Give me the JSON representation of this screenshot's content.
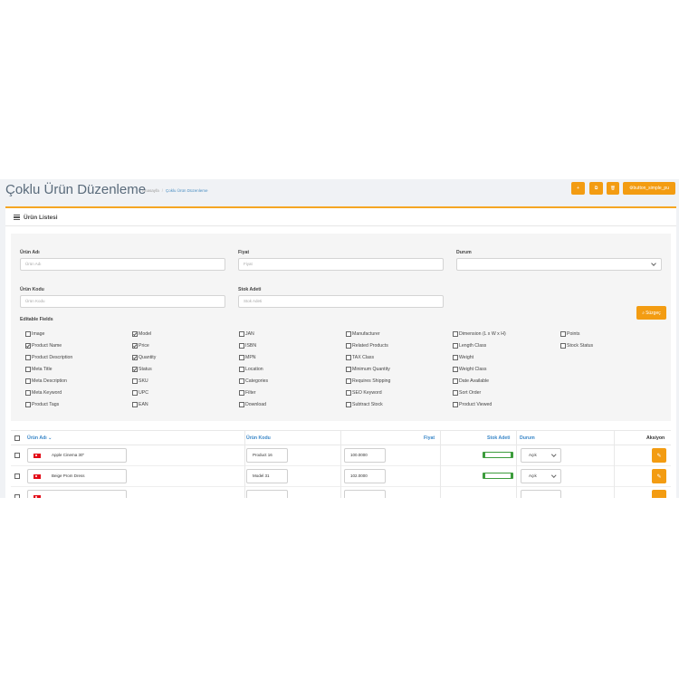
{
  "header": {
    "title": "Çoklu Ürün Düzenleme",
    "breadcrumb": [
      "Anasayfa",
      "Çoklu Ürün Düzenleme"
    ],
    "buttons": [
      {
        "icon": "plus-icon",
        "glyph": "+"
      },
      {
        "icon": "copy-icon",
        "glyph": "⧉"
      },
      {
        "icon": "trash-icon",
        "glyph": "🗑"
      },
      {
        "icon": "gear-icon",
        "glyph": "⚙",
        "label": "button_simple_pu"
      }
    ]
  },
  "panel": {
    "title": "Ürün Listesi"
  },
  "filters": {
    "product_name": {
      "label": "Ürün Adı",
      "placeholder": "Ürün Adı"
    },
    "price": {
      "label": "Fiyat",
      "placeholder": "Fiyat"
    },
    "status": {
      "label": "Durum",
      "value": ""
    },
    "product_code": {
      "label": "Ürün Kodu",
      "placeholder": "Ürün Kodu"
    },
    "stock": {
      "label": "Stok Adeti",
      "placeholder": "Stok Adeti"
    },
    "search_button": "Süzgeç"
  },
  "editable_fields": {
    "label": "Editable Fields",
    "columns": [
      [
        {
          "label": "Image",
          "checked": false
        },
        {
          "label": "Product Name",
          "checked": true
        },
        {
          "label": "Product Description",
          "checked": false
        },
        {
          "label": "Meta Title",
          "checked": false
        },
        {
          "label": "Meta Description",
          "checked": false
        },
        {
          "label": "Meta Keyword",
          "checked": false
        },
        {
          "label": "Product Tags",
          "checked": false
        }
      ],
      [
        {
          "label": "Model",
          "checked": true
        },
        {
          "label": "Price",
          "checked": true
        },
        {
          "label": "Quantity",
          "checked": true
        },
        {
          "label": "Status",
          "checked": true
        },
        {
          "label": "SKU",
          "checked": false
        },
        {
          "label": "UPC",
          "checked": false
        },
        {
          "label": "EAN",
          "checked": false
        }
      ],
      [
        {
          "label": "JAN",
          "checked": false
        },
        {
          "label": "ISBN",
          "checked": false
        },
        {
          "label": "MPN",
          "checked": false
        },
        {
          "label": "Location",
          "checked": false
        },
        {
          "label": "Categories",
          "checked": false
        },
        {
          "label": "Filter",
          "checked": false
        },
        {
          "label": "Download",
          "checked": false
        }
      ],
      [
        {
          "label": "Manufacturer",
          "checked": false
        },
        {
          "label": "Related Products",
          "checked": false
        },
        {
          "label": "TAX Class",
          "checked": false
        },
        {
          "label": "Minimum Quantity",
          "checked": false
        },
        {
          "label": "Requires Shipping",
          "checked": false
        },
        {
          "label": "SEO Keyword",
          "checked": false
        },
        {
          "label": "Subtract Stock",
          "checked": false
        }
      ],
      [
        {
          "label": "Dimension (L x W x H)",
          "checked": false
        },
        {
          "label": "Length Class",
          "checked": false
        },
        {
          "label": "Weight",
          "checked": false
        },
        {
          "label": "Weight Class",
          "checked": false
        },
        {
          "label": "Date Available",
          "checked": false
        },
        {
          "label": "Sort Order",
          "checked": false
        },
        {
          "label": "Product Viewed",
          "checked": false
        }
      ],
      [
        {
          "label": "Points",
          "checked": false
        },
        {
          "label": "Stock Status",
          "checked": false
        }
      ]
    ]
  },
  "table": {
    "headers": {
      "name": "Ürün Adı",
      "code": "Ürün Kodu",
      "price": "Fiyat",
      "stock": "Stok Adeti",
      "status": "Durum",
      "actions": "Aksiyon"
    },
    "rows": [
      {
        "name": "Apple Cinema 30\"",
        "code": "Product 16",
        "price": "100.0000",
        "status": "Açık"
      },
      {
        "name": "Beige Prom Dress",
        "code": "Model 31",
        "price": "102.0000",
        "status": "Açık"
      },
      {
        "name": "",
        "code": "",
        "price": "",
        "status": ""
      }
    ]
  },
  "colors": {
    "accent": "#f39c12",
    "link": "#3a87c8",
    "flag": "#e30a17",
    "stock_ok": "#3c9c3c"
  }
}
